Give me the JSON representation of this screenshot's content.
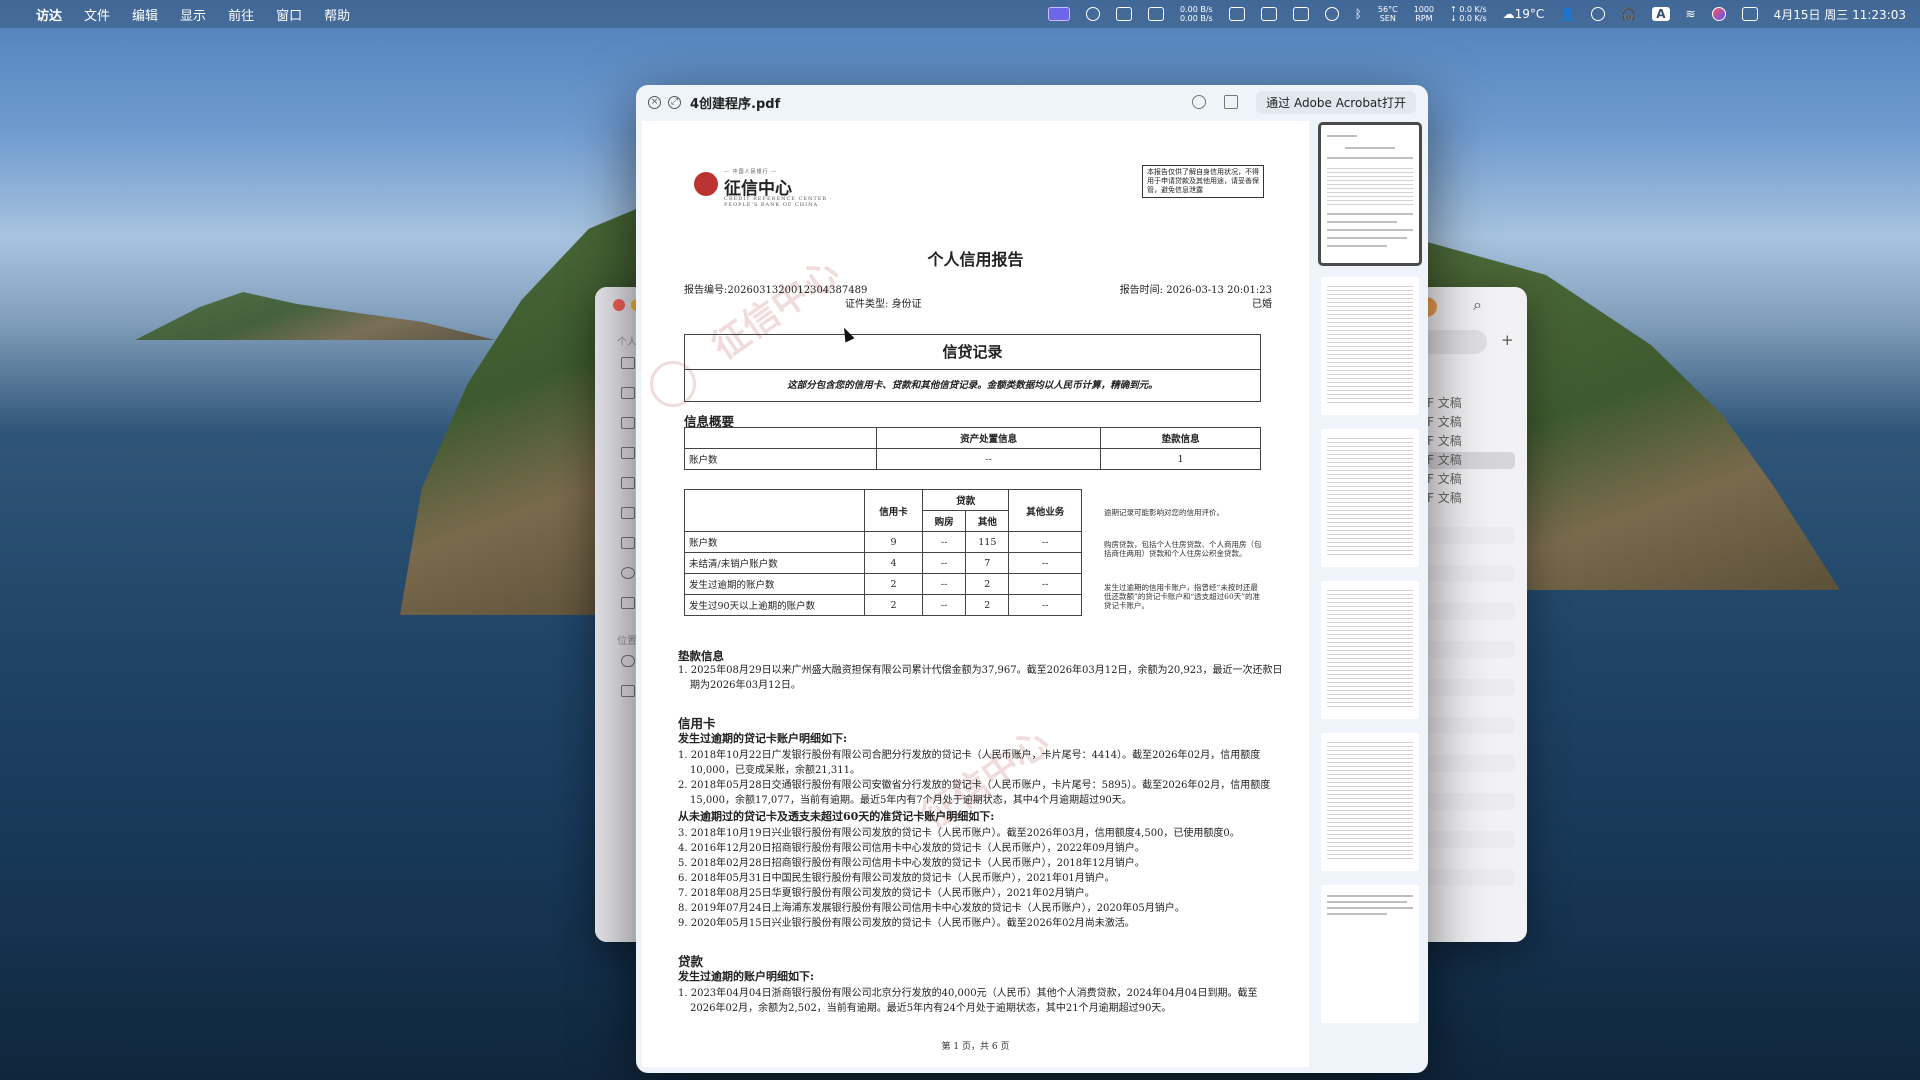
{
  "menubar": {
    "items": [
      "访达",
      "文件",
      "编辑",
      "显示",
      "前往",
      "窗口",
      "帮助"
    ],
    "net_up": "0.00 B/s",
    "net_down": "0.00 B/s",
    "cpu_temp": "56°C",
    "cpu_label": "SEN",
    "fan_rpm": "1000",
    "fan_label": "RPM",
    "disk_up": "↑ 0.0 K/s",
    "disk_down": "↓ 0.0 K/s",
    "weather": "19°C",
    "input_method": "A",
    "datetime": "4月15日 周三  11:23:03"
  },
  "pdf_window": {
    "title": "4创建程序.pdf",
    "open_with": "通过 Adobe Acrobat打开"
  },
  "finder": {
    "side_labels": [
      "个人",
      "位置"
    ],
    "rows": [
      "F 文稿",
      "F 文稿",
      "F 文稿",
      "F 文稿",
      "F 文稿",
      "F 文稿"
    ]
  },
  "report": {
    "logo_top": "— 中国人民银行 —",
    "logo_name": "征信中心",
    "logo_sub": "CREDIT REFERENCE CENTER · PEOPLE'S BANK OF CHINA",
    "notice": "本报告仅供了解自身信用状况，不得用于申请贷款及其他用途，请妥善保管，避免信息泄露",
    "title": "个人信用报告",
    "report_no_label": "报告编号:",
    "report_no": "2026031320012304387489",
    "report_time_label": "报告时间:",
    "report_time": "2026-03-13 20:01:23",
    "id_type_label": "证件类型:",
    "id_type": "身份证",
    "marital": "已婚",
    "credit_title": "信贷记录",
    "credit_desc": "这部分包含您的信用卡、贷款和其他信贷记录。金额类数据均以人民币计算，精确到元。",
    "summary_title": "信息概要",
    "summary_table": {
      "headers": [
        "",
        "资产处置信息",
        "垫款信息"
      ],
      "row_label": "账户数",
      "row_values": [
        "--",
        "1"
      ]
    },
    "main_table": {
      "h_credit": "信用卡",
      "h_loan": "贷款",
      "h_house": "购房",
      "h_other": "其他",
      "h_other_biz": "其他业务",
      "rows": [
        {
          "label": "账户数",
          "cc": "9",
          "house": "--",
          "other": "115",
          "biz": "--"
        },
        {
          "label": "未结清/未销户账户数",
          "cc": "4",
          "house": "--",
          "other": "7",
          "biz": "--"
        },
        {
          "label": "发生过逾期的账户数",
          "cc": "2",
          "house": "--",
          "other": "2",
          "biz": "--"
        },
        {
          "label": "发生过90天以上逾期的账户数",
          "cc": "2",
          "house": "--",
          "other": "2",
          "biz": "--"
        }
      ]
    },
    "side_notes": [
      "逾期记录可能影响对您的信用评价。",
      "购房贷款，包括个人住房贷款、个人商用房（包括商住两用）贷款和个人住房公积金贷款。",
      "发生过逾期的信用卡账户，指曾经“未按时还最低还款额”的贷记卡账户和“透支超过60天”的准贷记卡账户。"
    ],
    "advance_title": "垫款信息",
    "advance_lines": [
      "1. 2025年08月29日以来广州盛大融资担保有限公司累计代偿金额为37,967。截至2026年03月12日，余额为20,923，最近一次还款日",
      "期为2026年03月12日。"
    ],
    "cc_title": "信用卡",
    "cc_overdue_title": "发生过逾期的贷记卡账户明细如下:",
    "cc_overdue_lines": [
      "1. 2018年10月22日广发银行股份有限公司合肥分行发放的贷记卡（人民币账户，卡片尾号：4414）。截至2026年02月，信用额度",
      "10,000，已变成呆账，余额21,311。",
      "2. 2018年05月28日交通银行股份有限公司安徽省分行发放的贷记卡（人民币账户，卡片尾号：5895）。截至2026年02月，信用额度",
      "15,000，余额17,077，当前有逾期。最近5年内有7个月处于逾期状态，其中4个月逾期超过90天。"
    ],
    "cc_normal_title": "从未逾期过的贷记卡及透支未超过60天的准贷记卡账户明细如下:",
    "cc_normal_lines": [
      "3. 2018年10月19日兴业银行股份有限公司发放的贷记卡（人民币账户）。截至2026年03月，信用额度4,500，已使用额度0。",
      "4. 2016年12月20日招商银行股份有限公司信用卡中心发放的贷记卡（人民币账户），2022年09月销户。",
      "5. 2018年02月28日招商银行股份有限公司信用卡中心发放的贷记卡（人民币账户），2018年12月销户。",
      "6. 2018年05月31日中国民生银行股份有限公司发放的贷记卡（人民币账户），2021年01月销户。",
      "7. 2018年08月25日华夏银行股份有限公司发放的贷记卡（人民币账户），2021年02月销户。",
      "8. 2019年07月24日上海浦东发展银行股份有限公司信用卡中心发放的贷记卡（人民币账户），2020年05月销户。",
      "9. 2020年05月15日兴业银行股份有限公司发放的贷记卡（人民币账户）。截至2026年02月尚未激活。"
    ],
    "loan_title": "贷款",
    "loan_overdue_title": "发生过逾期的账户明细如下:",
    "loan_lines": [
      "1. 2023年04月04日浙商银行股份有限公司北京分行发放的40,000元（人民币）其他个人消费贷款，2024年04月04日到期。截至",
      "2026年02月，余额为2,502，当前有逾期。最近5年内有24个月处于逾期状态，其中21个月逾期超过90天。"
    ],
    "footer": "第 1 页，共 6 页",
    "watermark": "征信中心"
  },
  "thumbnails": {
    "count": 6,
    "selected": 1
  },
  "colors": {
    "accent_highlight": "#7a64ff",
    "seal_red": "#b33333"
  }
}
